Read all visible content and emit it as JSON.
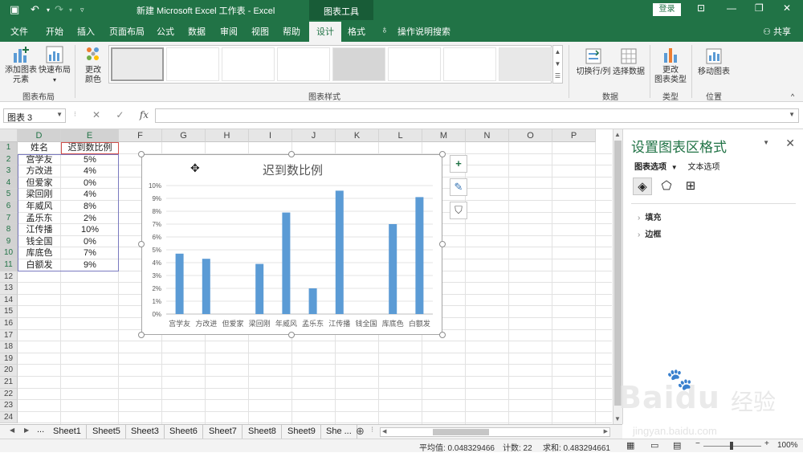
{
  "titlebar": {
    "title": "新建 Microsoft Excel 工作表  -  Excel",
    "context_tools": "图表工具",
    "login": "登录"
  },
  "tabs": [
    "文件",
    "开始",
    "插入",
    "页面布局",
    "公式",
    "数据",
    "审阅",
    "视图",
    "帮助",
    "设计",
    "格式"
  ],
  "active_tab": "设计",
  "tell_me": "操作说明搜索",
  "share": "共享",
  "ribbon": {
    "add_element": "添加图表\n元素",
    "quick_layout": "快速布局",
    "change_colors": "更改\n颜色",
    "group_layout": "图表布局",
    "group_styles": "图表样式",
    "switch_row_col": "切换行/列",
    "select_data": "选择数据",
    "group_data": "数据",
    "change_type": "更改\n图表类型",
    "group_type": "类型",
    "move_chart": "移动图表",
    "group_location": "位置"
  },
  "formula_bar": {
    "name_box": "图表 3",
    "fx": "fx",
    "value": ""
  },
  "columns": [
    "D",
    "E",
    "F",
    "G",
    "H",
    "I",
    "J",
    "K",
    "L",
    "M",
    "N",
    "O",
    "P"
  ],
  "rows": [
    "1",
    "2",
    "3",
    "4",
    "5",
    "6",
    "7",
    "8",
    "9",
    "10",
    "11",
    "12",
    "13",
    "14",
    "15",
    "16",
    "17",
    "18",
    "19",
    "20",
    "21",
    "22",
    "23",
    "24"
  ],
  "table": {
    "header_name": "姓名",
    "header_rate": "迟到数比例",
    "names": [
      "宫学友",
      "方改进",
      "但爱家",
      "梁回刚",
      "年威风",
      "孟乐东",
      "江传播",
      "钱全国",
      "库底色",
      "白额发"
    ],
    "rates": [
      "5%",
      "4%",
      "0%",
      "4%",
      "8%",
      "2%",
      "10%",
      "0%",
      "7%",
      "9%"
    ]
  },
  "chart_data": {
    "type": "bar",
    "title": "迟到数比例",
    "categories": [
      "宫学友",
      "方改进",
      "但爱家",
      "梁回刚",
      "年威风",
      "孟乐东",
      "江传播",
      "钱全国",
      "库底色",
      "白额发"
    ],
    "values": [
      0.047,
      0.043,
      0.0,
      0.039,
      0.079,
      0.02,
      0.096,
      0.0,
      0.07,
      0.091
    ],
    "yticks": [
      "0%",
      "1%",
      "2%",
      "3%",
      "4%",
      "5%",
      "6%",
      "7%",
      "8%",
      "9%",
      "10%"
    ],
    "ylim": [
      0,
      0.1
    ],
    "grid": true,
    "color": "#5b9bd5"
  },
  "chart_tools": {
    "add": "+",
    "style": "✎",
    "filter": "⛉"
  },
  "pane": {
    "title": "设置图表区格式",
    "tab_chart": "图表选项",
    "tab_text": "文本选项",
    "section_fill": "填充",
    "section_border": "边框",
    "close": "✕"
  },
  "sheet_tabs": [
    "Sheet1",
    "Sheet5",
    "Sheet3",
    "Sheet6",
    "Sheet7",
    "Sheet8",
    "Sheet9",
    "She ..."
  ],
  "sheet_ellipsis": "...",
  "status": {
    "average": "平均值: 0.048329466",
    "count": "计数: 22",
    "sum": "求和: 0.483294661",
    "zoom": "100%"
  },
  "watermark": {
    "brand": "Baidu",
    "cn": "经验",
    "url": "jingyan.baidu.com"
  },
  "colors": {
    "excel_green": "#217346",
    "bar_blue": "#5b9bd5"
  }
}
